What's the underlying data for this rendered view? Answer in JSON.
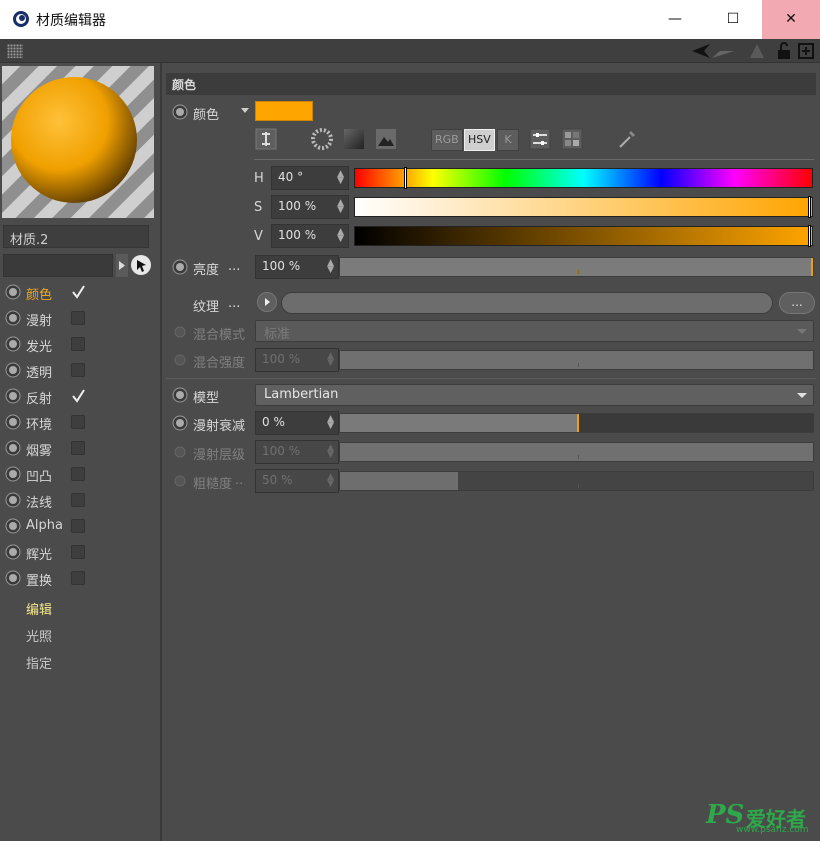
{
  "window": {
    "title": "材质编辑器",
    "minimize_glyph": "—",
    "maximize_glyph": "☐",
    "close_glyph": "✕"
  },
  "colors": {
    "accent": "#ffa500",
    "panel_bg": "#4b4b4b",
    "active_channel": "#f0a61a",
    "active_subnav": "#f5e88a"
  },
  "left": {
    "material_name": "材质.2",
    "channels": [
      {
        "label": "颜色",
        "checked": true,
        "active": true
      },
      {
        "label": "漫射",
        "checked": false
      },
      {
        "label": "发光",
        "checked": false
      },
      {
        "label": "透明",
        "checked": false
      },
      {
        "label": "反射",
        "checked": true
      },
      {
        "label": "环境",
        "checked": false
      },
      {
        "label": "烟雾",
        "checked": false
      },
      {
        "label": "凹凸",
        "checked": false
      },
      {
        "label": "法线",
        "checked": false
      },
      {
        "label": "Alpha",
        "checked": false
      },
      {
        "label": "辉光",
        "checked": false
      },
      {
        "label": "置换",
        "checked": false
      }
    ],
    "subnav": [
      {
        "label": "编辑",
        "active": true
      },
      {
        "label": "光照"
      },
      {
        "label": "指定"
      }
    ]
  },
  "main": {
    "section_title": "颜色",
    "color": {
      "label": "颜色",
      "swatch": "#ffa500",
      "modes": [
        "RGB",
        "HSV",
        "K"
      ],
      "selected_mode": "HSV",
      "h": {
        "letter": "H",
        "value": "40 °",
        "marker_fraction": 0.111
      },
      "s": {
        "letter": "S",
        "value": "100 %",
        "marker_fraction": 1.0
      },
      "v": {
        "letter": "V",
        "value": "100 %",
        "marker_fraction": 1.0
      }
    },
    "brightness": {
      "label": "亮度",
      "dots": "...",
      "value": "100 %",
      "fraction": 1.0
    },
    "texture": {
      "label": "纹理",
      "dots": "...",
      "more": "..."
    },
    "blend_mode": {
      "label": "混合模式",
      "value": "标准"
    },
    "blend_strength": {
      "label": "混合强度",
      "value": "100 %",
      "fraction": 1.0
    },
    "model": {
      "label": "模型",
      "value": "Lambertian"
    },
    "diffuse_falloff": {
      "label": "漫射衰减",
      "value": "0 %",
      "fraction": 0.5
    },
    "diffuse_level": {
      "label": "漫射层级",
      "value": "100 %",
      "fraction": 1.0
    },
    "roughness": {
      "label": "粗糙度",
      "dots": "..",
      "value": "50 %",
      "fraction": 0.25
    }
  },
  "watermark": {
    "ps": "PS",
    "cn": "爱好者",
    "url": "www.psahz.com"
  }
}
